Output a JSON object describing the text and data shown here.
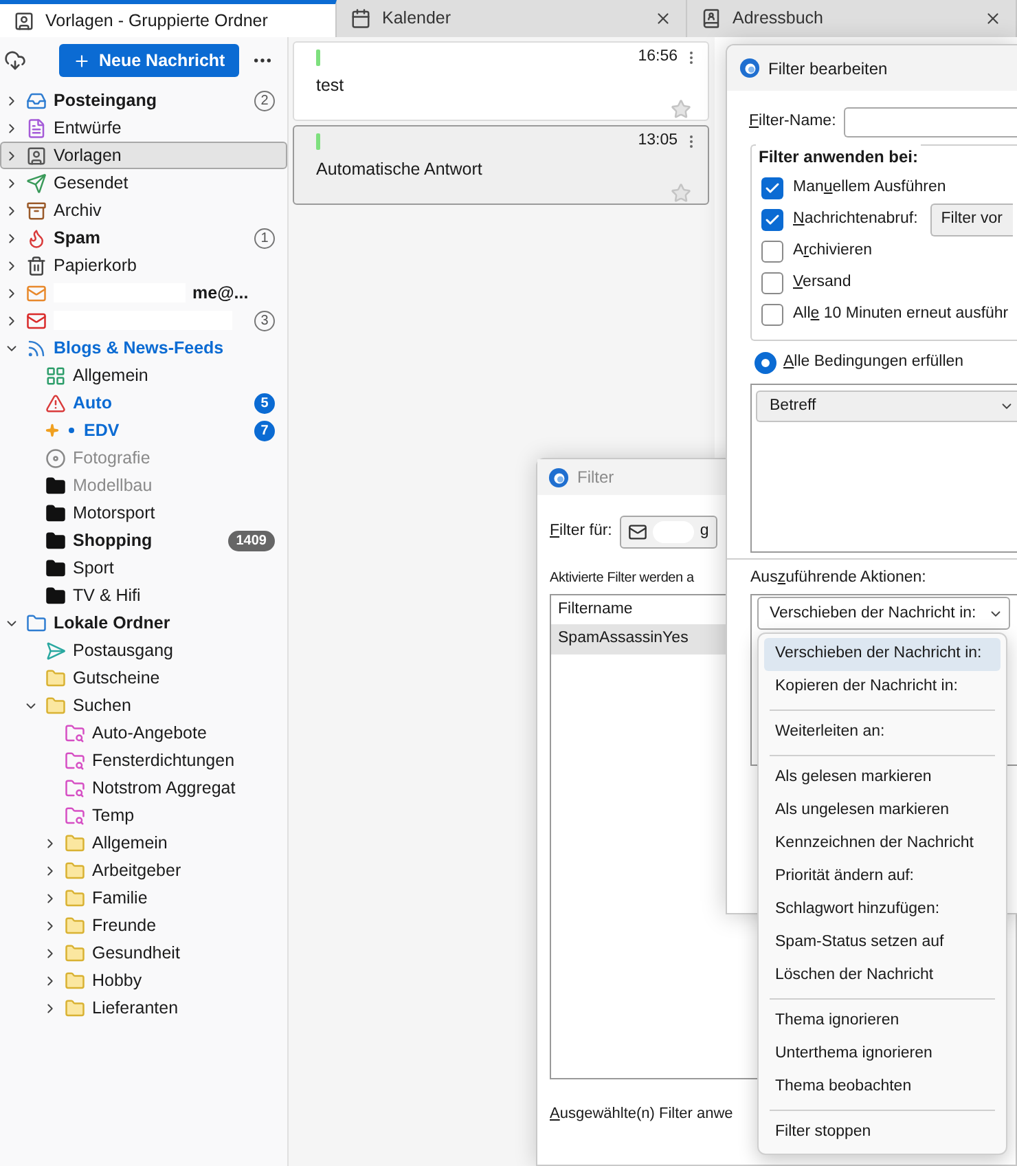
{
  "tabs": [
    {
      "label": "Vorlagen - Gruppierte Ordner",
      "kind": "templates",
      "selected": true,
      "closable": false
    },
    {
      "label": "Kalender",
      "kind": "calendar",
      "selected": false,
      "closable": true
    },
    {
      "label": "Adressbuch",
      "kind": "contacts",
      "selected": false,
      "closable": true
    }
  ],
  "toolbar": {
    "new_message": "Neue Nachricht"
  },
  "folders": [
    {
      "label": "Posteingang",
      "kind": "inbox",
      "expanded": false,
      "unread": true,
      "new": false,
      "selected": false,
      "badge": {
        "text": "2",
        "kind": "outline"
      }
    },
    {
      "label": "Entwürfe",
      "kind": "drafts",
      "expanded": false,
      "unread": false,
      "new": false,
      "selected": false
    },
    {
      "label": "Vorlagen",
      "kind": "templates",
      "expanded": false,
      "unread": false,
      "new": false,
      "selected": true
    },
    {
      "label": "Gesendet",
      "kind": "sent",
      "expanded": false,
      "unread": false,
      "new": false,
      "selected": false
    },
    {
      "label": "Archiv",
      "kind": "archive",
      "expanded": false,
      "unread": false,
      "new": false,
      "selected": false
    },
    {
      "label": "Spam",
      "kind": "spam",
      "expanded": false,
      "unread": true,
      "new": false,
      "selected": false,
      "badge": {
        "text": "1",
        "kind": "outline"
      }
    },
    {
      "label": "Papierkorb",
      "kind": "trash",
      "expanded": false,
      "unread": false,
      "new": false,
      "selected": false
    },
    {
      "label": "me@...",
      "kind": "account",
      "redacted": true,
      "expanded": false,
      "unread": true,
      "new": false,
      "selected": false
    },
    {
      "kind": "account-error",
      "redacted": true,
      "expanded": false,
      "new": false,
      "selected": false,
      "badge": {
        "text": "3",
        "kind": "outline"
      }
    },
    {
      "label": "Blogs & News-Feeds",
      "kind": "feeds",
      "expanded": true,
      "unread": true,
      "new": true,
      "selected": false,
      "children": [
        {
          "label": "Allgemein",
          "kind": "favicon",
          "unread": false,
          "new": false,
          "dimmed": false,
          "selected": false
        },
        {
          "label": "Auto",
          "kind": "alert-feed",
          "unread": true,
          "new": true,
          "dimmed": false,
          "selected": false,
          "badge": {
            "text": "5",
            "kind": "blue"
          }
        },
        {
          "label": "EDV",
          "kind": "new-feed",
          "unread": true,
          "new": true,
          "dimmed": false,
          "selected": false,
          "badge": {
            "text": "7",
            "kind": "blue"
          }
        },
        {
          "label": "Fotografie",
          "kind": "disc-feed",
          "unread": false,
          "new": false,
          "dimmed": true,
          "selected": false
        },
        {
          "label": "Modellbau",
          "kind": "feed-folder",
          "unread": false,
          "new": false,
          "dimmed": true,
          "selected": false
        },
        {
          "label": "Motorsport",
          "kind": "feed-folder",
          "unread": false,
          "new": false,
          "dimmed": false,
          "selected": false
        },
        {
          "label": "Shopping",
          "kind": "feed-folder",
          "unread": true,
          "new": false,
          "dimmed": false,
          "selected": false,
          "badge": {
            "text": "1409",
            "kind": "grey"
          }
        },
        {
          "label": "Sport",
          "kind": "feed-folder",
          "unread": false,
          "new": false,
          "dimmed": false,
          "selected": false
        },
        {
          "label": "TV & Hifi",
          "kind": "feed-folder",
          "unread": false,
          "new": false,
          "dimmed": false,
          "selected": false
        }
      ]
    },
    {
      "label": "Lokale Ordner",
      "kind": "local",
      "expanded": true,
      "unread": true,
      "new": false,
      "selected": false,
      "children": [
        {
          "label": "Postausgang",
          "kind": "outbox",
          "unread": false,
          "selected": false
        },
        {
          "label": "Gutscheine",
          "kind": "folder",
          "unread": false,
          "selected": false
        },
        {
          "label": "Suchen",
          "kind": "folder",
          "expanded": true,
          "unread": false,
          "selected": false,
          "children": [
            {
              "label": "Auto-Angebote",
              "kind": "search-folder",
              "unread": false,
              "selected": false
            },
            {
              "label": "Fensterdichtungen",
              "kind": "search-folder",
              "unread": false,
              "selected": false
            },
            {
              "label": "Notstrom Aggregat",
              "kind": "search-folder",
              "unread": false,
              "selected": false
            },
            {
              "label": "Temp",
              "kind": "search-folder",
              "unread": false,
              "selected": false
            },
            {
              "label": "Allgemein",
              "kind": "folder",
              "expanded": false,
              "unread": false,
              "selected": false
            },
            {
              "label": "Arbeitgeber",
              "kind": "folder",
              "expanded": false,
              "unread": false,
              "selected": false
            },
            {
              "label": "Familie",
              "kind": "folder",
              "expanded": false,
              "unread": false,
              "selected": false
            },
            {
              "label": "Freunde",
              "kind": "folder",
              "expanded": false,
              "unread": false,
              "selected": false
            },
            {
              "label": "Gesundheit",
              "kind": "folder",
              "expanded": false,
              "unread": false,
              "selected": false
            },
            {
              "label": "Hobby",
              "kind": "folder",
              "expanded": false,
              "unread": false,
              "selected": false
            },
            {
              "label": "Lieferanten",
              "kind": "folder",
              "expanded": false,
              "unread": false,
              "selected": false
            }
          ]
        }
      ]
    }
  ],
  "messages": [
    {
      "time": "16:56",
      "subject": "test",
      "selected": false
    },
    {
      "time": "13:05",
      "subject": "Automatische Antwort",
      "selected": true
    }
  ],
  "filter_dialog": {
    "title": "Filter",
    "filter_for": {
      "key": "F",
      "post": "ilter für:"
    },
    "account_value": "g",
    "hint": "Aktivierte Filter werden a",
    "column": "Filtername",
    "rows": [
      {
        "name": "SpamAssassinYes",
        "selected": true
      }
    ],
    "footer": {
      "key": "A",
      "post": "usgewählte(n) Filter anwe"
    }
  },
  "edit_dialog": {
    "title": "Filter bearbeiten",
    "name_label": {
      "key": "F",
      "post": "ilter-Name:"
    },
    "apply_legend": "Filter anwenden bei:",
    "apply_options": [
      {
        "label": {
          "pre": "Man",
          "key": "u",
          "post": "ellem Ausführen"
        },
        "checked": true
      },
      {
        "label": {
          "key": "N",
          "post": "achrichtenabruf:"
        },
        "checked": true,
        "button": "Filter vor"
      },
      {
        "label": {
          "pre": "A",
          "key": "r",
          "post": "chivieren"
        },
        "checked": false
      },
      {
        "label": {
          "key": "V",
          "post": "ersand"
        },
        "checked": false
      },
      {
        "label": {
          "pre": "All",
          "key": "e",
          "post": " 10 Minuten erneut ausführ"
        },
        "checked": false
      }
    ],
    "match": {
      "label": {
        "key": "A",
        "post": "lle Bedingungen erfüllen"
      },
      "selected": true
    },
    "conditions": [
      {
        "field": "Betreff"
      }
    ],
    "actions_label": {
      "pre": "Aus",
      "key": "z",
      "post": "uführende Aktionen:"
    },
    "action_select": "Verschieben der Nachricht in:",
    "action_menu": [
      [
        {
          "label": "Verschieben der Nachricht in:",
          "selected": true
        },
        {
          "label": "Kopieren der Nachricht in:",
          "selected": false
        }
      ],
      [
        {
          "label": "Weiterleiten an:",
          "selected": false
        }
      ],
      [
        {
          "label": "Als gelesen markieren",
          "selected": false
        },
        {
          "label": "Als ungelesen markieren",
          "selected": false
        },
        {
          "label": "Kennzeichnen der Nachricht",
          "selected": false
        },
        {
          "label": "Priorität ändern auf:",
          "selected": false
        },
        {
          "label": "Schlagwort hinzufügen:",
          "selected": false
        },
        {
          "label": "Spam-Status setzen auf",
          "selected": false
        },
        {
          "label": "Löschen der Nachricht",
          "selected": false
        }
      ],
      [
        {
          "label": "Thema ignorieren",
          "selected": false
        },
        {
          "label": "Unterthema ignorieren",
          "selected": false
        },
        {
          "label": "Thema beobachten",
          "selected": false
        }
      ],
      [
        {
          "label": "Filter stoppen",
          "selected": false
        }
      ]
    ]
  }
}
